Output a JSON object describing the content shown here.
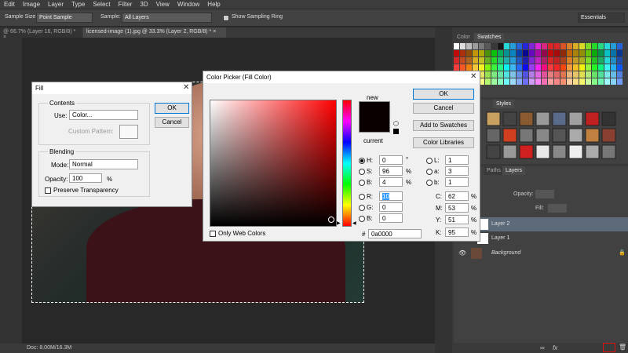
{
  "menu": [
    "Edit",
    "Image",
    "Layer",
    "Type",
    "Select",
    "Filter",
    "3D",
    "View",
    "Window",
    "Help"
  ],
  "options": {
    "sample_size_label": "Sample Size:",
    "sample_size_value": "Point Sample",
    "sample_label": "Sample:",
    "sample_value": "All Layers",
    "show_ring": "Show Sampling Ring",
    "workspace": "Essentials"
  },
  "tabs": [
    {
      "label": "@ 66.7% (Layer 16, RGB/8) *",
      "close": "×"
    },
    {
      "label": "licensed-image (1).jpg @ 33.3% (Layer 2, RGB/8) *",
      "close": "×"
    }
  ],
  "status": {
    "doc": "Doc: 8.00M/16.3M"
  },
  "swatches_panel": {
    "tab_color": "Color",
    "tab_swatches": "Swatches"
  },
  "styles_panel": {
    "tab_styles": "Styles"
  },
  "layers_panel": {
    "tab_paths": "Paths",
    "tab_layers": "Layers",
    "opacity_label": "Opacity:",
    "fill_label": "Fill:",
    "layers": [
      "Layer 2",
      "Layer 1",
      "Background"
    ]
  },
  "fill": {
    "title": "Fill",
    "contents_label": "Contents",
    "use_label": "Use:",
    "use_value": "Color...",
    "custom_pattern_label": "Custom Pattern:",
    "blending_label": "Blending",
    "mode_label": "Mode:",
    "mode_value": "Normal",
    "opacity_label": "Opacity:",
    "opacity_value": "100",
    "percent": "%",
    "preserve": "Preserve Transparency",
    "ok": "OK",
    "cancel": "Cancel"
  },
  "picker": {
    "title": "Color Picker (Fill Color)",
    "ok": "OK",
    "cancel": "Cancel",
    "add": "Add to Swatches",
    "libs": "Color Libraries",
    "new_label": "new",
    "current_label": "current",
    "only_web": "Only Web Colors",
    "hsb": [
      {
        "label": "H:",
        "value": "0",
        "unit": "°"
      },
      {
        "label": "S:",
        "value": "96",
        "unit": "%"
      },
      {
        "label": "B:",
        "value": "4",
        "unit": "%"
      }
    ],
    "rgb": [
      {
        "label": "R:",
        "value": "10"
      },
      {
        "label": "G:",
        "value": "0"
      },
      {
        "label": "B:",
        "value": "0"
      }
    ],
    "lab": [
      {
        "label": "L:",
        "value": "1"
      },
      {
        "label": "a:",
        "value": "3"
      },
      {
        "label": "b:",
        "value": "1"
      }
    ],
    "cmyk": [
      {
        "label": "C:",
        "value": "62",
        "unit": "%"
      },
      {
        "label": "M:",
        "value": "53",
        "unit": "%"
      },
      {
        "label": "Y:",
        "value": "51",
        "unit": "%"
      },
      {
        "label": "K:",
        "value": "95",
        "unit": "%"
      }
    ],
    "hex_label": "#",
    "hex_value": "0a0000",
    "selected_color": "#0a0000"
  }
}
